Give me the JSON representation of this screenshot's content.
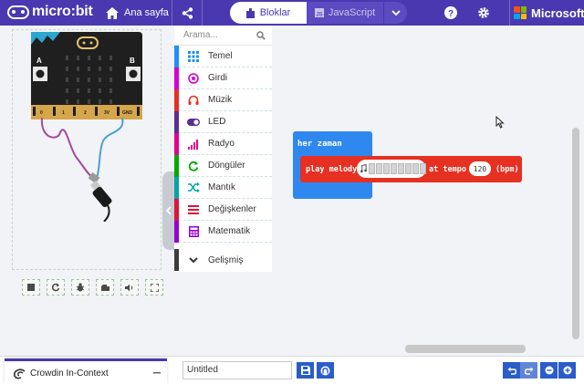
{
  "header": {
    "logo_text": "micro:bit",
    "home_label": "Ana sayfa",
    "tabs": [
      {
        "label": "Bloklar",
        "active": true
      },
      {
        "label": "JavaScript",
        "active": false
      }
    ],
    "brand": "Microsoft",
    "icons": [
      "home-icon",
      "share-icon",
      "puzzle-icon",
      "js-icon",
      "chevron-down-icon",
      "help-icon",
      "gear-icon"
    ]
  },
  "simulator": {
    "pin_labels": [
      "0",
      "1",
      "2",
      "3V",
      "GND"
    ],
    "controls": [
      "stop-icon",
      "restart-icon",
      "debug-icon",
      "slowmo-icon",
      "mute-icon",
      "fullscreen-icon"
    ]
  },
  "toolbox": {
    "search_placeholder": "Arama...",
    "categories": [
      {
        "label": "Temel",
        "color": "#1e90ff",
        "icon": "grid-icon"
      },
      {
        "label": "Girdi",
        "color": "#d400d4",
        "icon": "target-icon"
      },
      {
        "label": "Müzik",
        "color": "#e63022",
        "icon": "headphones-icon"
      },
      {
        "label": "LED",
        "color": "#5c2d91",
        "icon": "toggle-icon"
      },
      {
        "label": "Radyo",
        "color": "#e3008c",
        "icon": "signal-icon"
      },
      {
        "label": "Döngüler",
        "color": "#00aa00",
        "icon": "loop-icon"
      },
      {
        "label": "Mantık",
        "color": "#00a4a6",
        "icon": "shuffle-icon"
      },
      {
        "label": "Değişkenler",
        "color": "#dc143c",
        "icon": "lines-icon"
      },
      {
        "label": "Matematik",
        "color": "#9400d3",
        "icon": "calculator-icon"
      }
    ],
    "advanced_label": "Gelişmiş"
  },
  "workspace": {
    "event_block": {
      "label": "her zaman",
      "color": "#2f87f0"
    },
    "melody_block": {
      "prefix": "play melody",
      "middle": "at tempo",
      "tempo": "120",
      "suffix": "(bpm)",
      "color": "#e63022"
    }
  },
  "footer": {
    "crowdin_label": "Crowdin In-Context",
    "project_name": "Untitled"
  }
}
